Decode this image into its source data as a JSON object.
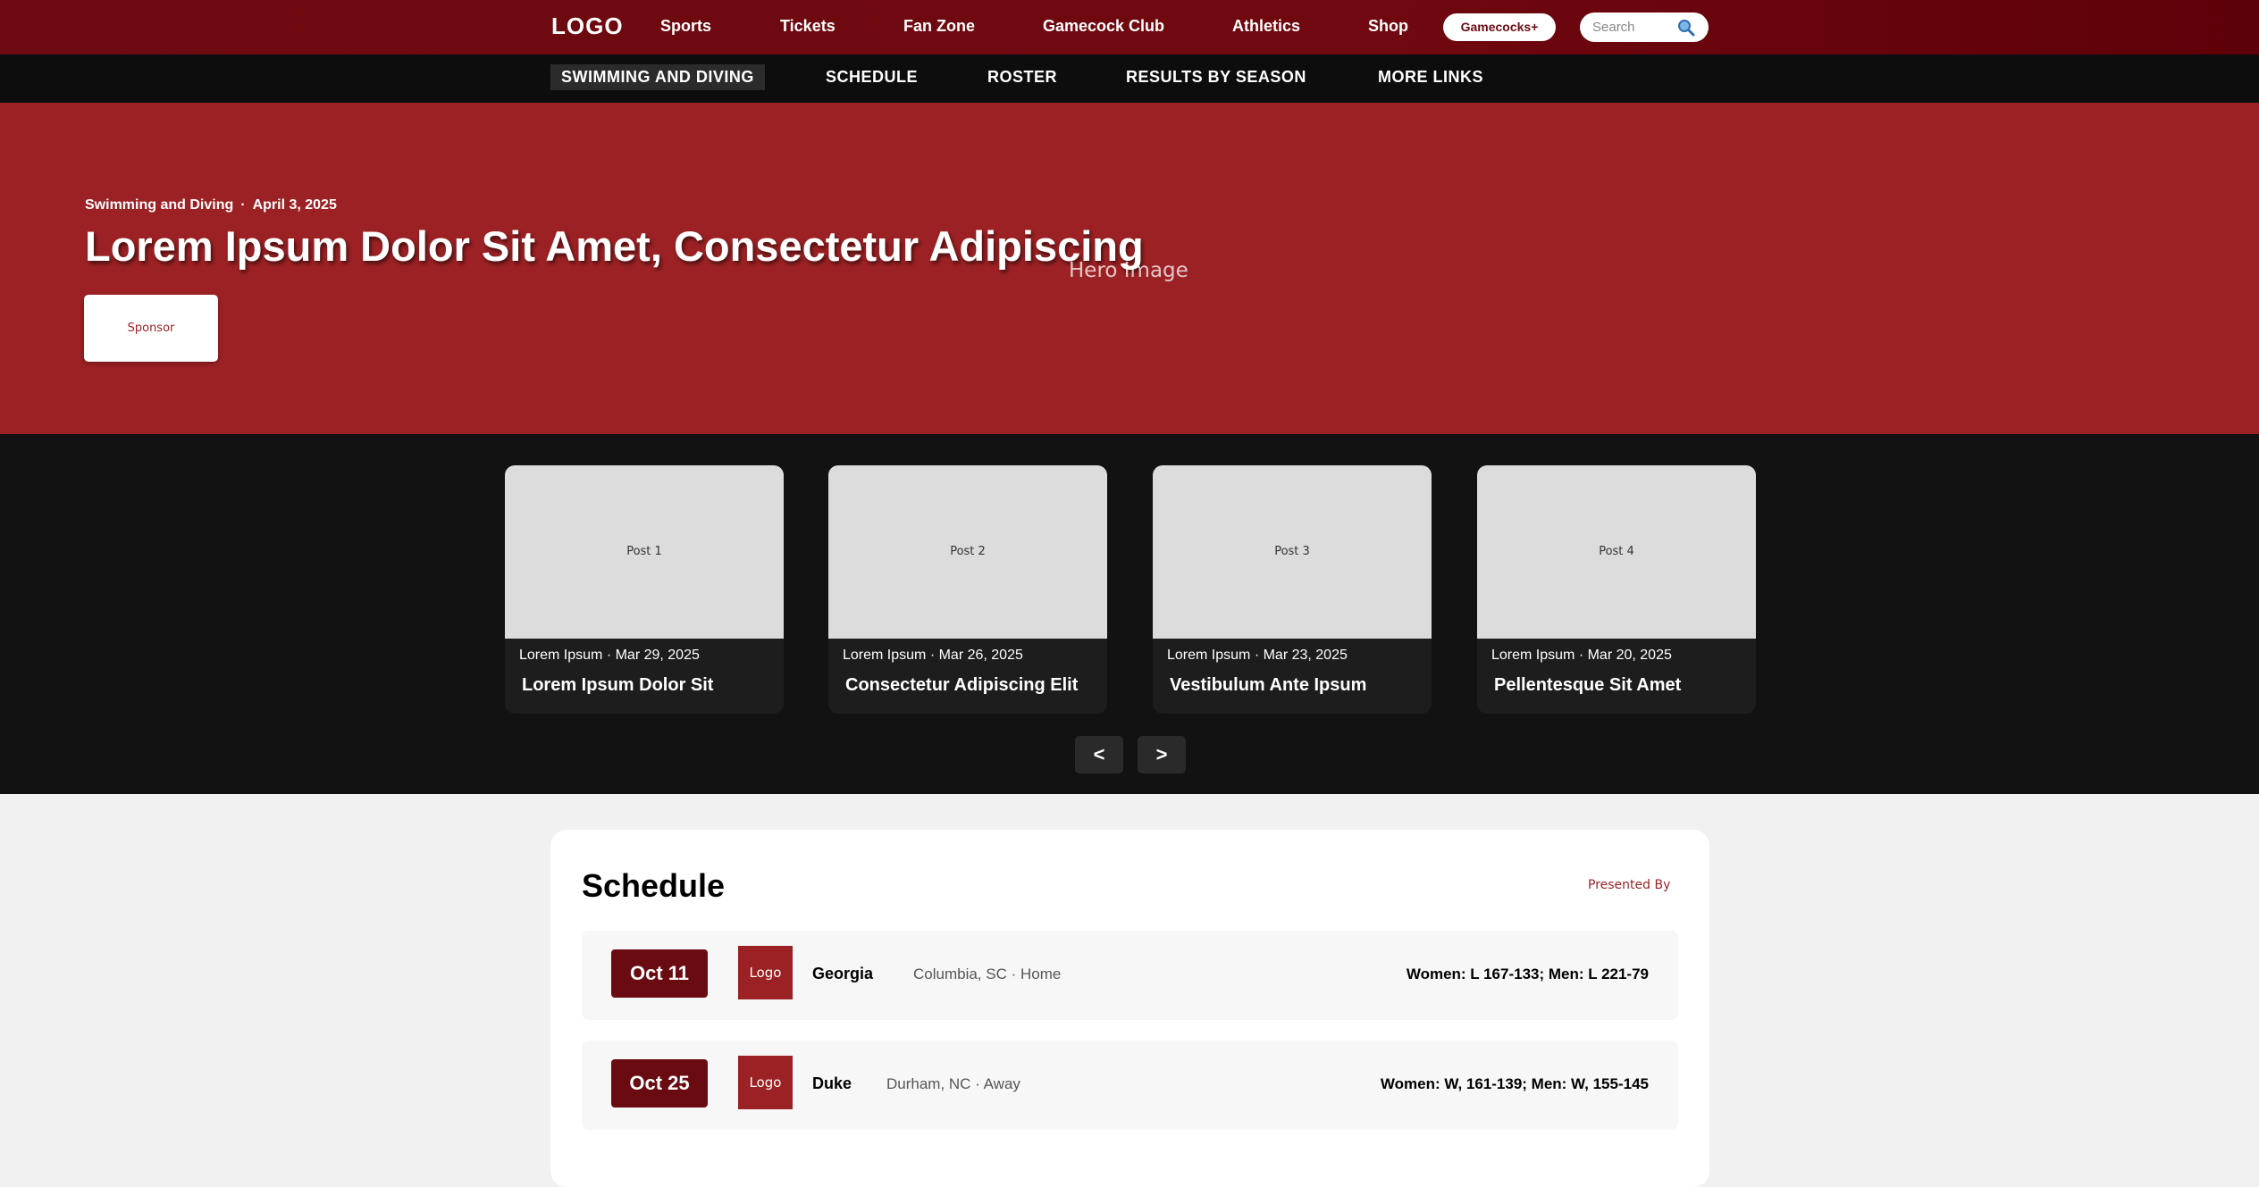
{
  "topnav": {
    "logo": "LOGO",
    "links": [
      "Sports",
      "Tickets",
      "Fan Zone",
      "Gamecock Club",
      "Athletics",
      "Shop"
    ],
    "plus_button": "Gamecocks+",
    "search_placeholder": "Search",
    "search_icon": "search-icon"
  },
  "subnav": {
    "items": [
      "SWIMMING AND DIVING",
      "SCHEDULE",
      "ROSTER",
      "RESULTS BY SEASON",
      "MORE LINKS"
    ],
    "active": "SWIMMING AND DIVING"
  },
  "hero": {
    "category": "Swimming and Diving",
    "separator": "·",
    "date": "April 3, 2025",
    "title": "Lorem Ipsum Dolor Sit Amet, Consectetur Adipiscing",
    "image_label": "Hero Image",
    "sponsor": "Sponsor"
  },
  "posts": {
    "items": [
      {
        "thumb": "Post 1",
        "meta": "Lorem Ipsum · Mar 29, 2025",
        "title": "Lorem Ipsum Dolor Sit"
      },
      {
        "thumb": "Post 2",
        "meta": "Lorem Ipsum · Mar 26, 2025",
        "title": "Consectetur Adipiscing Elit"
      },
      {
        "thumb": "Post 3",
        "meta": "Lorem Ipsum · Mar 23, 2025",
        "title": "Vestibulum Ante Ipsum"
      },
      {
        "thumb": "Post 4",
        "meta": "Lorem Ipsum · Mar 20, 2025",
        "title": "Pellentesque Sit Amet"
      }
    ],
    "prev": "<",
    "next": ">"
  },
  "schedule": {
    "title": "Schedule",
    "presented_by": "Presented By",
    "rows": [
      {
        "date": "Oct 11",
        "logo": "Logo",
        "opponent": "Georgia",
        "location": "Columbia, SC · Home",
        "result": "Women: L 167-133; Men: L 221-79"
      },
      {
        "date": "Oct 25",
        "logo": "Logo",
        "opponent": "Duke",
        "location": "Durham, NC · Away",
        "result": "Women: W, 161-139; Men: W, 155-145"
      }
    ]
  },
  "colors": {
    "brand_dark": "#6d0a11",
    "hero_red": "#9c2124",
    "subnav_bg": "#0d0d0d",
    "posts_bg": "#121212"
  }
}
